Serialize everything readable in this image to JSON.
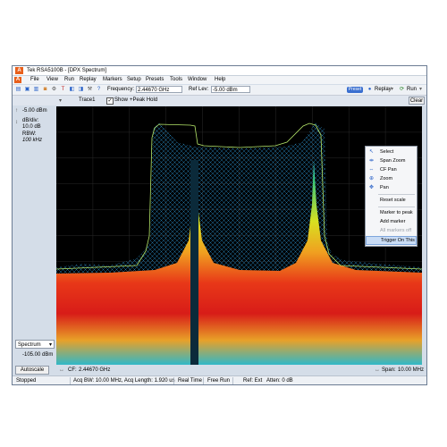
{
  "window": {
    "app_title": "Tek RSA5100B - [DPX Spectrum]"
  },
  "menubar": {
    "items": [
      "File",
      "View",
      "Run",
      "Replay",
      "Markers",
      "Setup",
      "Presets",
      "Tools",
      "Window",
      "Help"
    ]
  },
  "toolbar": {
    "frequency_label": "Frequency:",
    "frequency_value": "2.44670 GHz",
    "ref_lev_label": "Ref Lev:",
    "ref_lev_value": "-5.00 dBm",
    "preset_label": "Preset",
    "replay_label": "Replay",
    "run_label": "Run"
  },
  "trace_bar": {
    "trace_name": "Trace1",
    "show_label": "Show",
    "show_checked": true,
    "detector_label": "+Peak Hold",
    "clear_label": "Clear"
  },
  "left_panel": {
    "top_ref": "-5.00 dBm",
    "db_div_label": "dB/div:",
    "db_div_value": "10.0 dB",
    "rbw_label": "RBW:",
    "rbw_value": "100 kHz",
    "display_select": "Spectrum",
    "bottom_ref": "-105.00 dBm",
    "autoscale_label": "Autoscale"
  },
  "bottom_info": {
    "cf_label": "CF:",
    "cf_value": "2.44670 GHz",
    "span_label": "Span:",
    "span_value": "10.00 MHz"
  },
  "status": {
    "state": "Stopped",
    "acq": "Acq BW: 10.00 MHz, Acq Length: 1.920 us",
    "mode": "Real Time",
    "trigger": "Free Run",
    "ref": "Ref: Ext",
    "atten": "Atten: 0 dB"
  },
  "context_menu": {
    "items": [
      "Select",
      "Span Zoom",
      "CF Pan",
      "Zoom",
      "Pan",
      "Reset scale",
      "Marker to peak",
      "Add marker",
      "All markers off",
      "Trigger On This"
    ],
    "icons": [
      "cursor-icon",
      "span-zoom-icon",
      "cf-pan-icon",
      "zoom-icon",
      "pan-icon"
    ],
    "disabled_item": "All markers off",
    "highlighted_item": "Trigger On This"
  },
  "colors": {
    "trace_cyan": "#38b6e8",
    "preset_blue": "#3a6fd0",
    "app_icon": "#e8601c"
  }
}
